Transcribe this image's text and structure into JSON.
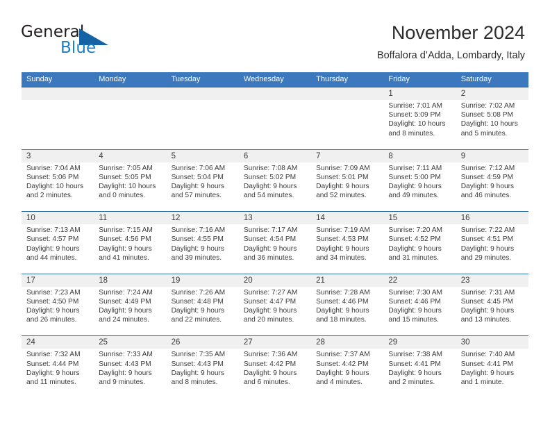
{
  "brand": {
    "word_one": "General",
    "word_two": "Blue",
    "mark": "triangle-logo-icon",
    "colors": {
      "text": "#231f20",
      "accent": "#1a7fc1"
    }
  },
  "header": {
    "title": "November 2024",
    "subtitle": "Boffalora d’Adda, Lombardy, Italy"
  },
  "theme": {
    "header_blue": "#3b78be",
    "row_divider_blue": "#2e6da4",
    "date_band_gray": "#f0f0f0",
    "text": "#3a3a3a"
  },
  "calendar": {
    "day_headers": [
      "Sunday",
      "Monday",
      "Tuesday",
      "Wednesday",
      "Thursday",
      "Friday",
      "Saturday"
    ],
    "weeks": [
      [
        {
          "day": "",
          "info": ""
        },
        {
          "day": "",
          "info": ""
        },
        {
          "day": "",
          "info": ""
        },
        {
          "day": "",
          "info": ""
        },
        {
          "day": "",
          "info": ""
        },
        {
          "day": "1",
          "info": "Sunrise: 7:01 AM\nSunset: 5:09 PM\nDaylight: 10 hours\nand 8 minutes."
        },
        {
          "day": "2",
          "info": "Sunrise: 7:02 AM\nSunset: 5:08 PM\nDaylight: 10 hours\nand 5 minutes."
        }
      ],
      [
        {
          "day": "3",
          "info": "Sunrise: 7:04 AM\nSunset: 5:06 PM\nDaylight: 10 hours\nand 2 minutes."
        },
        {
          "day": "4",
          "info": "Sunrise: 7:05 AM\nSunset: 5:05 PM\nDaylight: 10 hours\nand 0 minutes."
        },
        {
          "day": "5",
          "info": "Sunrise: 7:06 AM\nSunset: 5:04 PM\nDaylight: 9 hours\nand 57 minutes."
        },
        {
          "day": "6",
          "info": "Sunrise: 7:08 AM\nSunset: 5:02 PM\nDaylight: 9 hours\nand 54 minutes."
        },
        {
          "day": "7",
          "info": "Sunrise: 7:09 AM\nSunset: 5:01 PM\nDaylight: 9 hours\nand 52 minutes."
        },
        {
          "day": "8",
          "info": "Sunrise: 7:11 AM\nSunset: 5:00 PM\nDaylight: 9 hours\nand 49 minutes."
        },
        {
          "day": "9",
          "info": "Sunrise: 7:12 AM\nSunset: 4:59 PM\nDaylight: 9 hours\nand 46 minutes."
        }
      ],
      [
        {
          "day": "10",
          "info": "Sunrise: 7:13 AM\nSunset: 4:57 PM\nDaylight: 9 hours\nand 44 minutes."
        },
        {
          "day": "11",
          "info": "Sunrise: 7:15 AM\nSunset: 4:56 PM\nDaylight: 9 hours\nand 41 minutes."
        },
        {
          "day": "12",
          "info": "Sunrise: 7:16 AM\nSunset: 4:55 PM\nDaylight: 9 hours\nand 39 minutes."
        },
        {
          "day": "13",
          "info": "Sunrise: 7:17 AM\nSunset: 4:54 PM\nDaylight: 9 hours\nand 36 minutes."
        },
        {
          "day": "14",
          "info": "Sunrise: 7:19 AM\nSunset: 4:53 PM\nDaylight: 9 hours\nand 34 minutes."
        },
        {
          "day": "15",
          "info": "Sunrise: 7:20 AM\nSunset: 4:52 PM\nDaylight: 9 hours\nand 31 minutes."
        },
        {
          "day": "16",
          "info": "Sunrise: 7:22 AM\nSunset: 4:51 PM\nDaylight: 9 hours\nand 29 minutes."
        }
      ],
      [
        {
          "day": "17",
          "info": "Sunrise: 7:23 AM\nSunset: 4:50 PM\nDaylight: 9 hours\nand 26 minutes."
        },
        {
          "day": "18",
          "info": "Sunrise: 7:24 AM\nSunset: 4:49 PM\nDaylight: 9 hours\nand 24 minutes."
        },
        {
          "day": "19",
          "info": "Sunrise: 7:26 AM\nSunset: 4:48 PM\nDaylight: 9 hours\nand 22 minutes."
        },
        {
          "day": "20",
          "info": "Sunrise: 7:27 AM\nSunset: 4:47 PM\nDaylight: 9 hours\nand 20 minutes."
        },
        {
          "day": "21",
          "info": "Sunrise: 7:28 AM\nSunset: 4:46 PM\nDaylight: 9 hours\nand 18 minutes."
        },
        {
          "day": "22",
          "info": "Sunrise: 7:30 AM\nSunset: 4:46 PM\nDaylight: 9 hours\nand 15 minutes."
        },
        {
          "day": "23",
          "info": "Sunrise: 7:31 AM\nSunset: 4:45 PM\nDaylight: 9 hours\nand 13 minutes."
        }
      ],
      [
        {
          "day": "24",
          "info": "Sunrise: 7:32 AM\nSunset: 4:44 PM\nDaylight: 9 hours\nand 11 minutes."
        },
        {
          "day": "25",
          "info": "Sunrise: 7:33 AM\nSunset: 4:43 PM\nDaylight: 9 hours\nand 9 minutes."
        },
        {
          "day": "26",
          "info": "Sunrise: 7:35 AM\nSunset: 4:43 PM\nDaylight: 9 hours\nand 8 minutes."
        },
        {
          "day": "27",
          "info": "Sunrise: 7:36 AM\nSunset: 4:42 PM\nDaylight: 9 hours\nand 6 minutes."
        },
        {
          "day": "28",
          "info": "Sunrise: 7:37 AM\nSunset: 4:42 PM\nDaylight: 9 hours\nand 4 minutes."
        },
        {
          "day": "29",
          "info": "Sunrise: 7:38 AM\nSunset: 4:41 PM\nDaylight: 9 hours\nand 2 minutes."
        },
        {
          "day": "30",
          "info": "Sunrise: 7:40 AM\nSunset: 4:41 PM\nDaylight: 9 hours\nand 1 minute."
        }
      ]
    ]
  }
}
